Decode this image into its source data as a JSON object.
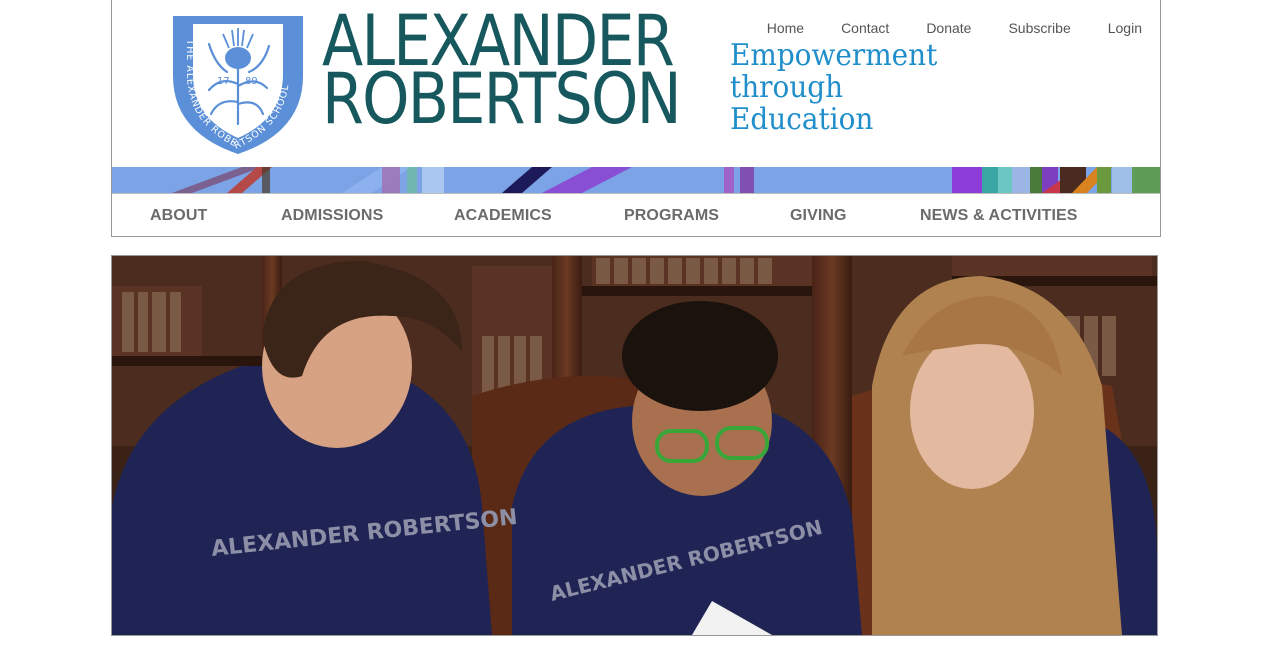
{
  "header": {
    "seal_text": "THE ALEXANDER ROBERTSON SCHOOL",
    "seal_year_left": "17",
    "seal_year_right": "89",
    "name_line1": "ALEXANDER",
    "name_line2": "ROBERTSON",
    "tagline": [
      "Empowerment",
      "through",
      "Education"
    ],
    "brand_color": "#16585e",
    "tagline_color": "#1f8ecb",
    "seal_color": "#5b8fd8"
  },
  "top_nav": [
    "Home",
    "Contact",
    "Donate",
    "Subscribe",
    "Login"
  ],
  "main_nav": [
    "ABOUT",
    "ADMISSIONS",
    "ACADEMICS",
    "PROGRAMS",
    "GIVING",
    "NEWS & ACTIVITIES"
  ],
  "hero": {
    "shirt_text": "ALEXANDER ROBERTSON"
  }
}
